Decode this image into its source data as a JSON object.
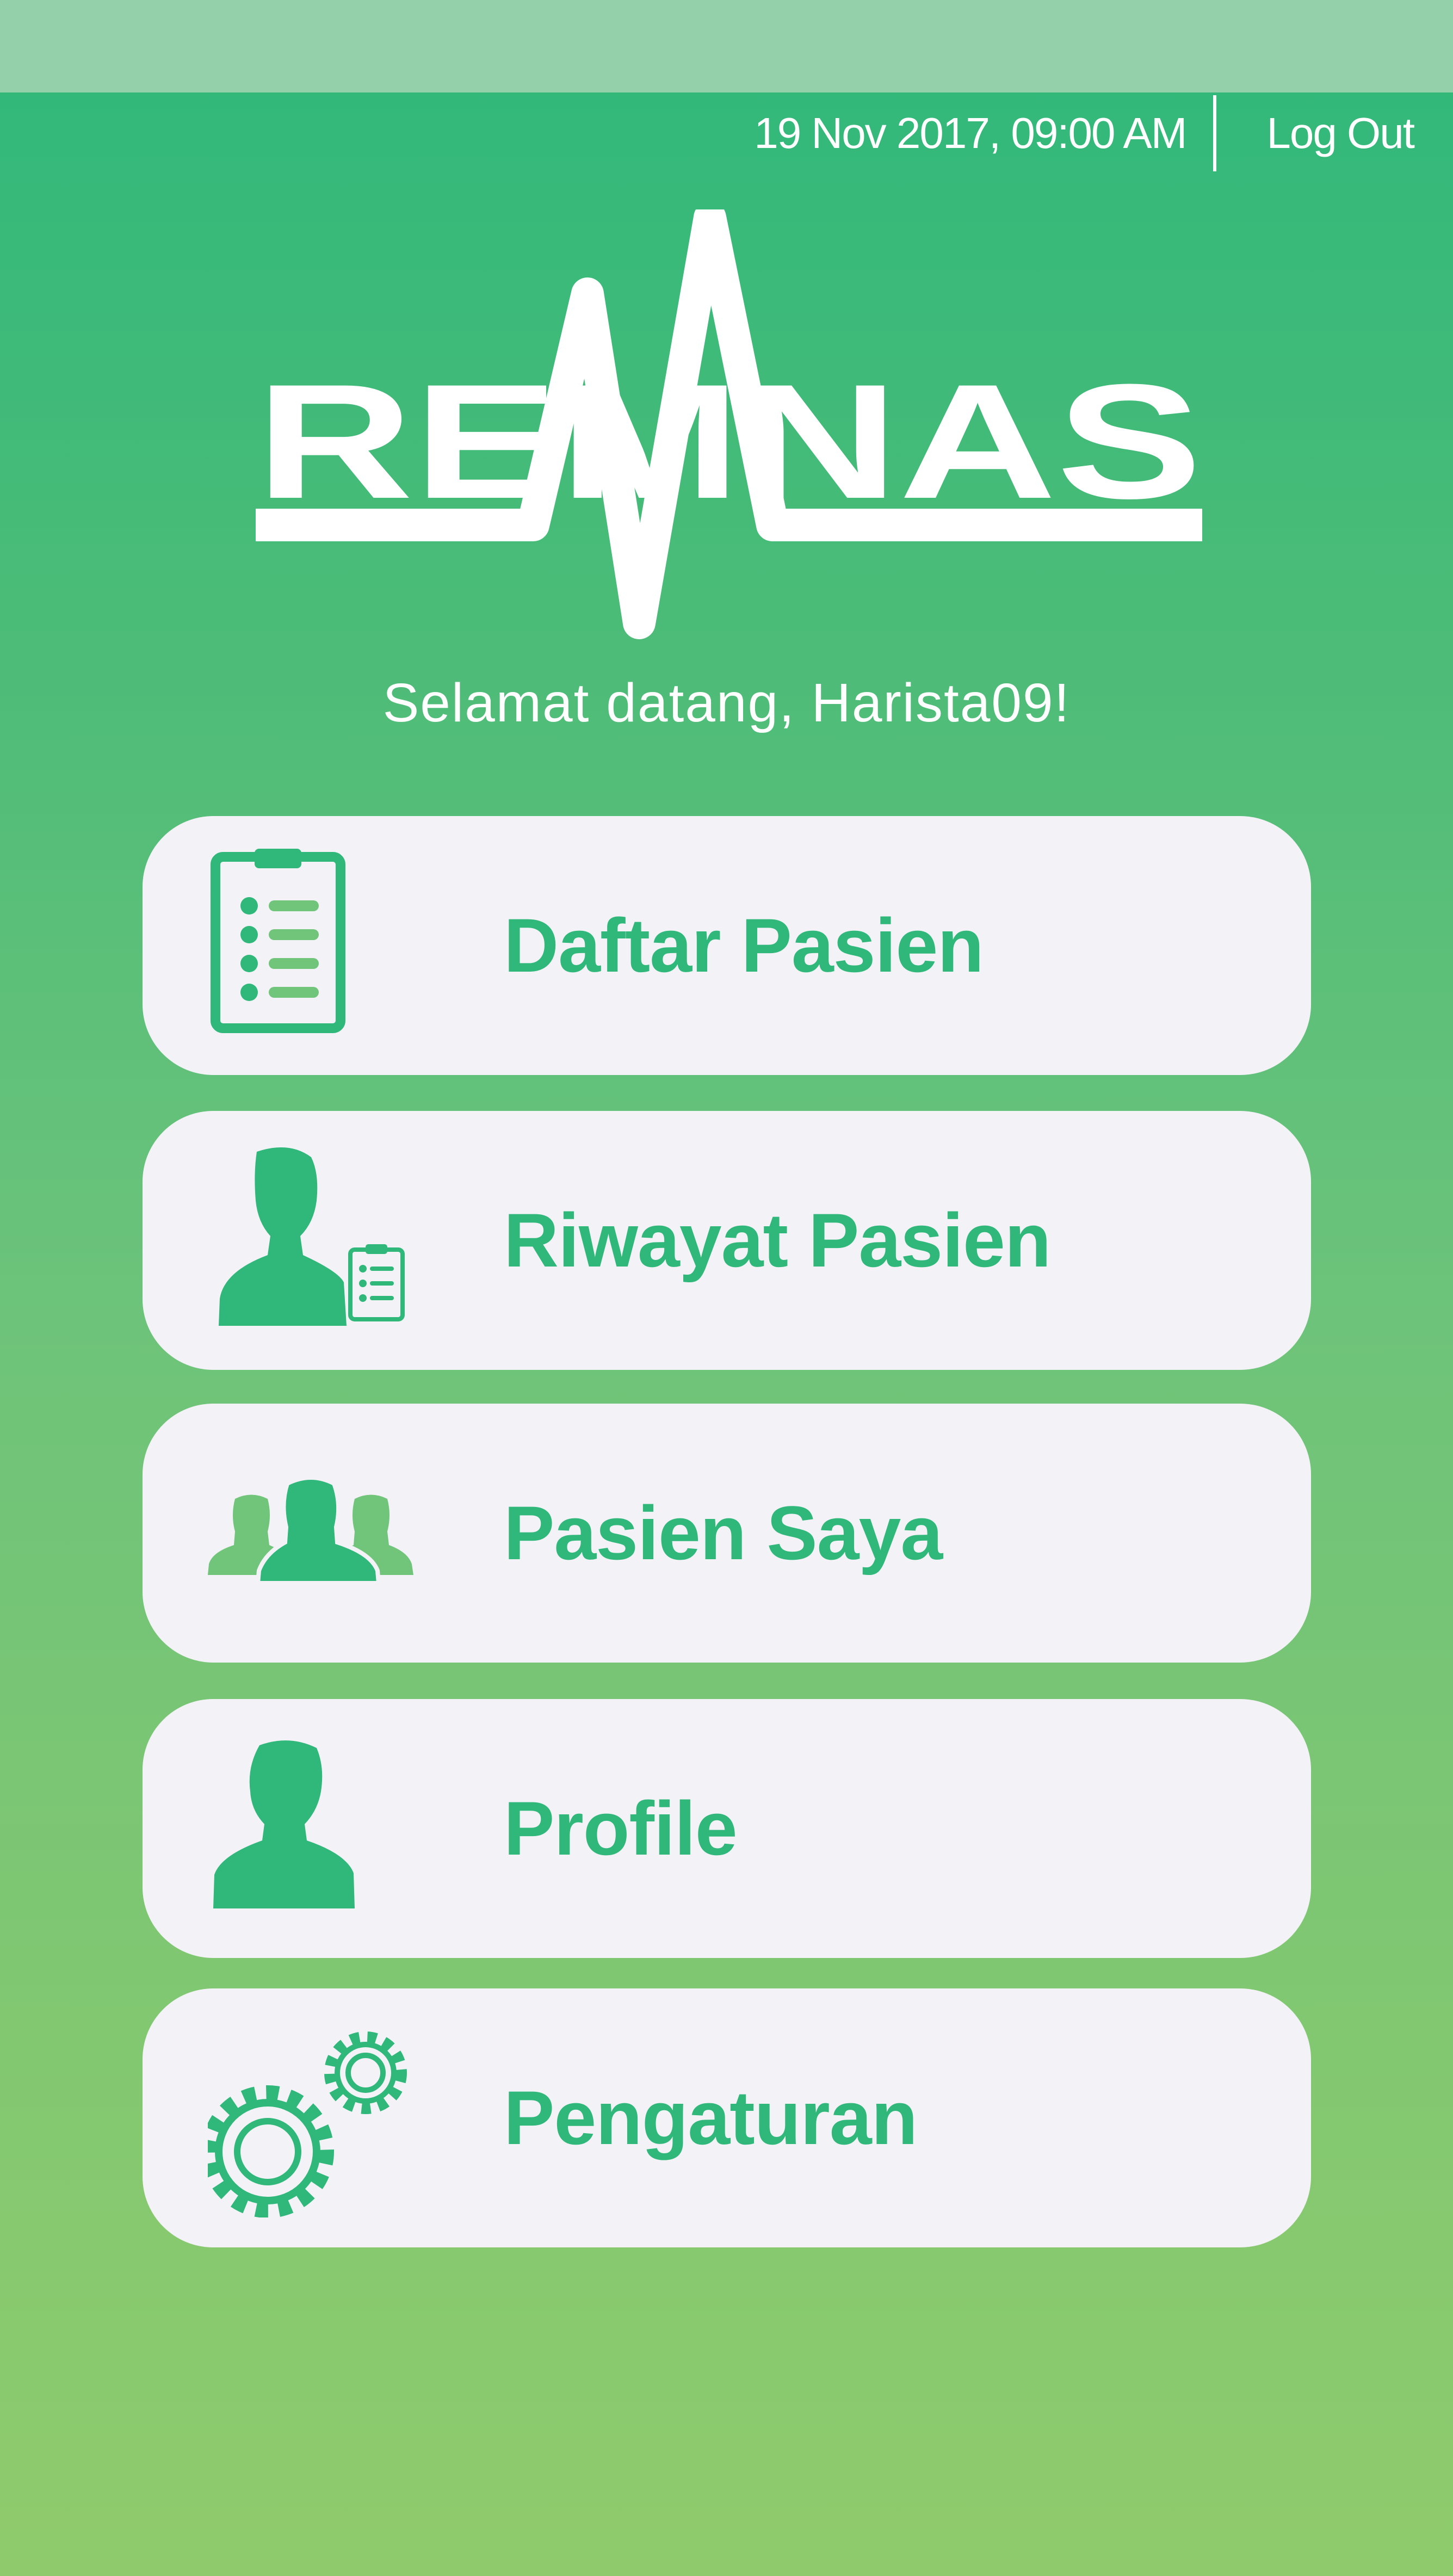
{
  "header": {
    "datetime": "19 Nov 2017, 09:00 AM",
    "logout_label": "Log Out"
  },
  "brand": {
    "name": "REMNAS"
  },
  "welcome_text": "Selamat datang, Harista09!",
  "menu": [
    {
      "label": "Daftar Pasien",
      "icon": "clipboard-list-icon"
    },
    {
      "label": "Riwayat Pasien",
      "icon": "patient-history-icon"
    },
    {
      "label": "Pasien Saya",
      "icon": "patient-group-icon"
    },
    {
      "label": "Profile",
      "icon": "user-icon"
    },
    {
      "label": "Pengaturan",
      "icon": "gears-icon"
    }
  ],
  "colors": {
    "accent": "#2fb87a",
    "card": "#f3f3f7",
    "status_strip": "#94d1aa"
  }
}
